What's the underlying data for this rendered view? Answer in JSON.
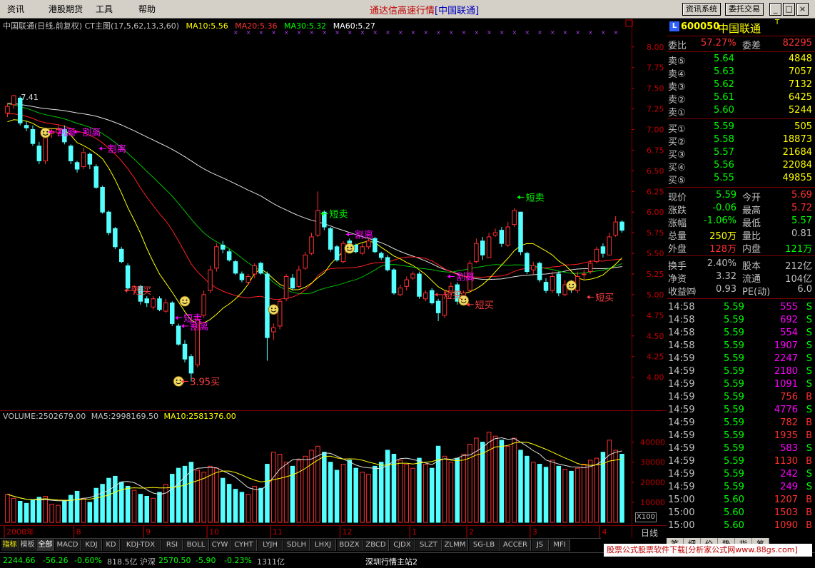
{
  "menu": [
    "资讯",
    "港股期货",
    "工具",
    "帮助"
  ],
  "window": {
    "title": "通达信高速行情",
    "server": "[中国联通]",
    "btn_info": "资讯系统",
    "btn_trade": "委托交易"
  },
  "chart": {
    "main_header": "中国联通(日线,前复权) CT主图(17,5,62,13,3,60)",
    "ma_labels": {
      "ma10": "MA10:5.56",
      "ma20": "MA20:5.36",
      "ma30": "MA30:5.32",
      "ma60": "MA60:5.27"
    },
    "vol_header": "VOLUME:2502679.00",
    "vol_ma5": "MA5:2998169.50",
    "vol_ma10": "MA10:2581376.00",
    "x100": "X100",
    "period": "日线"
  },
  "chart_data": {
    "type": "candlestick",
    "title": "中国联通(日线,前复权)",
    "yticks": [
      "8.00",
      "7.75",
      "7.50",
      "7.25",
      "7.00",
      "6.75",
      "6.50",
      "6.25",
      "6.00",
      "5.75",
      "5.50",
      "5.25",
      "5.00",
      "4.75",
      "4.50",
      "4.25",
      "4.00"
    ],
    "ylim": [
      3.85,
      8.05
    ],
    "vticks": [
      "40000",
      "30000",
      "20000",
      "10000"
    ],
    "vlim": [
      0,
      47000
    ],
    "xlabels": [
      "2008年",
      "8",
      "9",
      "10",
      "11",
      "12",
      "1",
      "2",
      "3",
      "4"
    ],
    "xlabel_index": [
      0,
      11,
      22,
      32,
      42,
      53,
      64,
      73,
      83,
      94
    ],
    "high_label": "7.41",
    "low_label": "3.95",
    "annotations": [
      {
        "text": "割离",
        "i": 6,
        "price": 6.97,
        "color": "#ff00ff"
      },
      {
        "text": "割离",
        "i": 10,
        "price": 6.97,
        "color": "#ff00ff"
      },
      {
        "text": "割离",
        "i": 14,
        "price": 6.77,
        "color": "#ff00ff"
      },
      {
        "text": "短买",
        "i": 18,
        "price": 5.05,
        "color": "#ff4040"
      },
      {
        "text": "短卖",
        "i": 26,
        "price": 4.72,
        "color": "#ff00ff"
      },
      {
        "text": "割离",
        "i": 27,
        "price": 4.62,
        "color": "#ff00ff"
      },
      {
        "text": "3.95买",
        "i": 27,
        "price": 3.95,
        "color": "#ff4040"
      },
      {
        "text": "短卖",
        "i": 49,
        "price": 5.98,
        "color": "#00ff00"
      },
      {
        "text": "割离",
        "i": 53,
        "price": 5.73,
        "color": "#ff00ff"
      },
      {
        "text": "割离",
        "i": 69,
        "price": 5.22,
        "color": "#ff00ff"
      },
      {
        "text": "短买",
        "i": 67,
        "price": 5.0,
        "color": "#ff4040"
      },
      {
        "text": "短买",
        "i": 72,
        "price": 4.88,
        "color": "#ff4040"
      },
      {
        "text": "短卖",
        "i": 80,
        "price": 6.18,
        "color": "#00ff00"
      },
      {
        "text": "短买",
        "i": 91,
        "price": 4.97,
        "color": "#ff4040"
      }
    ],
    "smiles": [
      {
        "i": 6,
        "price": 6.96
      },
      {
        "i": 28,
        "price": 4.92
      },
      {
        "i": 27,
        "price": 3.95
      },
      {
        "i": 42,
        "price": 4.82
      },
      {
        "i": 54,
        "price": 5.56
      },
      {
        "i": 72,
        "price": 4.93
      },
      {
        "i": 89,
        "price": 5.11
      }
    ],
    "close": [
      7.28,
      7.41,
      7.08,
      7.02,
      6.83,
      6.62,
      6.9,
      6.98,
      7.0,
      6.85,
      6.62,
      6.52,
      6.72,
      6.58,
      6.3,
      6.0,
      5.75,
      5.58,
      5.4,
      5.08,
      5.1,
      4.92,
      4.9,
      4.95,
      4.82,
      4.9,
      4.65,
      4.4,
      4.22,
      4.05,
      4.7,
      5.0,
      5.3,
      5.58,
      5.55,
      5.42,
      5.26,
      5.18,
      5.22,
      5.35,
      5.26,
      4.48,
      4.6,
      4.92,
      5.22,
      5.08,
      5.3,
      5.48,
      5.7,
      6.02,
      5.82,
      5.55,
      5.42,
      5.62,
      5.6,
      5.52,
      5.58,
      5.65,
      5.52,
      5.45,
      5.3,
      5.02,
      5.08,
      5.18,
      5.25,
      4.98,
      5.02,
      4.9,
      4.78,
      5.0,
      5.1,
      4.92,
      5.02,
      5.38,
      5.62,
      5.48,
      5.7,
      5.75,
      5.62,
      5.82,
      6.02,
      5.52,
      5.28,
      5.35,
      5.18,
      5.05,
      5.22,
      5.02,
      5.12,
      5.08,
      5.22,
      5.25,
      5.38,
      5.55,
      5.5,
      5.7,
      5.88,
      5.78
    ],
    "open": [
      7.2,
      7.3,
      7.38,
      7.05,
      7.0,
      6.8,
      6.62,
      6.95,
      6.96,
      7.0,
      6.8,
      6.6,
      6.55,
      6.7,
      6.55,
      6.3,
      6.0,
      5.8,
      5.55,
      5.35,
      5.05,
      5.1,
      4.95,
      4.85,
      4.95,
      4.8,
      4.9,
      4.62,
      4.4,
      4.25,
      4.15,
      4.75,
      5.05,
      5.32,
      5.6,
      5.52,
      5.4,
      5.25,
      5.15,
      5.25,
      5.38,
      5.25,
      4.55,
      4.62,
      4.95,
      5.2,
      5.1,
      5.32,
      5.5,
      5.72,
      6.0,
      5.8,
      5.58,
      5.4,
      5.65,
      5.6,
      5.5,
      5.58,
      5.68,
      5.5,
      5.45,
      5.3,
      5.0,
      5.1,
      5.2,
      5.25,
      4.95,
      5.05,
      4.92,
      4.75,
      5.02,
      5.12,
      4.9,
      5.05,
      5.4,
      5.65,
      5.45,
      5.72,
      5.78,
      5.6,
      5.85,
      6.0,
      5.5,
      5.3,
      5.38,
      5.15,
      5.05,
      5.25,
      5.0,
      5.15,
      5.05,
      5.25,
      5.28,
      5.4,
      5.58,
      5.48,
      5.72,
      5.88
    ],
    "high": [
      7.32,
      7.42,
      7.4,
      7.1,
      7.05,
      6.85,
      6.95,
      7.02,
      7.05,
      7.05,
      6.82,
      6.62,
      6.78,
      6.72,
      6.58,
      6.32,
      6.02,
      5.82,
      5.58,
      5.38,
      5.12,
      5.12,
      4.98,
      4.98,
      4.98,
      4.95,
      4.92,
      4.65,
      4.45,
      4.28,
      4.75,
      5.05,
      5.35,
      5.62,
      5.65,
      5.55,
      5.42,
      5.28,
      5.25,
      5.38,
      5.4,
      5.28,
      4.65,
      4.95,
      5.25,
      5.25,
      5.35,
      5.52,
      5.75,
      6.25,
      6.02,
      5.82,
      5.6,
      5.65,
      5.68,
      5.62,
      5.62,
      5.68,
      5.7,
      5.52,
      5.48,
      5.32,
      5.12,
      5.22,
      5.28,
      5.28,
      5.05,
      5.08,
      4.95,
      5.05,
      5.15,
      5.15,
      5.05,
      5.42,
      5.68,
      5.7,
      5.75,
      5.8,
      5.82,
      5.88,
      6.05,
      6.0,
      5.52,
      5.4,
      5.4,
      5.2,
      5.28,
      5.28,
      5.18,
      5.18,
      5.28,
      5.3,
      5.42,
      5.58,
      5.62,
      5.75,
      5.95,
      5.9
    ],
    "low": [
      7.15,
      7.25,
      7.05,
      6.98,
      6.8,
      6.58,
      6.58,
      6.9,
      6.92,
      6.82,
      6.58,
      6.48,
      6.52,
      6.52,
      6.28,
      5.98,
      5.72,
      5.55,
      5.38,
      5.05,
      5.0,
      4.88,
      4.85,
      4.82,
      4.8,
      4.78,
      4.62,
      4.38,
      4.18,
      3.95,
      4.12,
      4.72,
      5.02,
      5.28,
      5.5,
      5.4,
      5.24,
      5.15,
      5.12,
      5.2,
      5.24,
      4.2,
      4.45,
      4.58,
      4.92,
      5.05,
      5.08,
      5.3,
      5.48,
      5.7,
      5.78,
      5.52,
      5.4,
      5.38,
      5.55,
      5.5,
      5.48,
      5.55,
      5.5,
      5.42,
      5.28,
      5.0,
      4.98,
      5.05,
      5.18,
      4.95,
      4.92,
      4.88,
      4.68,
      4.72,
      5.0,
      4.88,
      4.88,
      5.02,
      5.38,
      5.42,
      5.45,
      5.7,
      5.58,
      5.58,
      5.82,
      5.48,
      5.25,
      5.25,
      5.15,
      5.02,
      5.02,
      4.98,
      4.98,
      5.02,
      5.02,
      5.18,
      5.25,
      5.38,
      5.45,
      5.48,
      5.7,
      5.75
    ],
    "volume": [
      14000,
      12000,
      10500,
      9500,
      11000,
      12500,
      13000,
      9000,
      8500,
      10500,
      13500,
      15500,
      12000,
      10000,
      17000,
      19000,
      22000,
      23000,
      20000,
      18000,
      16000,
      14000,
      13000,
      12000,
      15000,
      19000,
      24000,
      27000,
      28000,
      30000,
      26000,
      25000,
      28000,
      27000,
      22000,
      19000,
      16500,
      15000,
      14000,
      18000,
      17000,
      29000,
      35000,
      34000,
      30000,
      28000,
      31000,
      33000,
      36000,
      38000,
      35000,
      30000,
      26000,
      29000,
      31000,
      27000,
      25000,
      24000,
      28000,
      30000,
      36000,
      34000,
      31000,
      29000,
      27000,
      32000,
      29000,
      27000,
      38000,
      33000,
      30000,
      32000,
      34000,
      39000,
      42000,
      40000,
      45000,
      43000,
      41000,
      38000,
      42000,
      36000,
      33000,
      30000,
      29000,
      27500,
      31000,
      28000,
      26500,
      25500,
      27000,
      29000,
      31000,
      32000,
      35000,
      41000,
      36000,
      34000
    ]
  },
  "quote": {
    "code": "600050",
    "name": "中国联通",
    "tflag": "T",
    "wb_label": "委比",
    "wb_value": "57.27%",
    "wc_label": "委差",
    "wc_value": "82295",
    "asks": [
      {
        "l": "卖⑤",
        "p": "5.64",
        "v": "4848"
      },
      {
        "l": "卖④",
        "p": "5.63",
        "v": "7057"
      },
      {
        "l": "卖③",
        "p": "5.62",
        "v": "7132"
      },
      {
        "l": "卖②",
        "p": "5.61",
        "v": "6425"
      },
      {
        "l": "卖①",
        "p": "5.60",
        "v": "5244"
      }
    ],
    "bids": [
      {
        "l": "买①",
        "p": "5.59",
        "v": "505"
      },
      {
        "l": "买②",
        "p": "5.58",
        "v": "18873"
      },
      {
        "l": "买③",
        "p": "5.57",
        "v": "21684"
      },
      {
        "l": "买④",
        "p": "5.56",
        "v": "22084"
      },
      {
        "l": "买⑤",
        "p": "5.55",
        "v": "49855"
      }
    ],
    "stats": [
      {
        "l1": "现价",
        "v1": "5.59",
        "l2": "今开",
        "v2": "5.69"
      },
      {
        "l1": "涨跌",
        "v1": "-0.06",
        "l2": "最高",
        "v2": "5.72"
      },
      {
        "l1": "涨幅",
        "v1": "-1.06%",
        "l2": "最低",
        "v2": "5.57"
      },
      {
        "l1": "总量",
        "v1": "250万",
        "l2": "量比",
        "v2": "0.81"
      },
      {
        "l1": "外盘",
        "v1": "128万",
        "l2": "内盘",
        "v2": "121万"
      }
    ],
    "fin": [
      {
        "l1": "换手",
        "v1": "2.40%",
        "l2": "股本",
        "v2": "212亿"
      },
      {
        "l1": "净资",
        "v1": "3.32",
        "l2": "流通",
        "v2": "104亿"
      },
      {
        "l1": "收益㈣",
        "v1": "0.93",
        "l2": "PE(动)",
        "v2": "6.0"
      }
    ],
    "ticks": [
      {
        "t": "14:58",
        "p": "5.59",
        "v": "555",
        "s": "S"
      },
      {
        "t": "14:58",
        "p": "5.59",
        "v": "692",
        "s": "S"
      },
      {
        "t": "14:58",
        "p": "5.59",
        "v": "554",
        "s": "S"
      },
      {
        "t": "14:58",
        "p": "5.59",
        "v": "1907",
        "s": "S"
      },
      {
        "t": "14:59",
        "p": "5.59",
        "v": "2247",
        "s": "S"
      },
      {
        "t": "14:59",
        "p": "5.59",
        "v": "2180",
        "s": "S"
      },
      {
        "t": "14:59",
        "p": "5.59",
        "v": "1091",
        "s": "S"
      },
      {
        "t": "14:59",
        "p": "5.59",
        "v": "756",
        "s": "B"
      },
      {
        "t": "14:59",
        "p": "5.59",
        "v": "4776",
        "s": "S"
      },
      {
        "t": "14:59",
        "p": "5.59",
        "v": "782",
        "s": "B"
      },
      {
        "t": "14:59",
        "p": "5.59",
        "v": "1935",
        "s": "B"
      },
      {
        "t": "14:59",
        "p": "5.59",
        "v": "583",
        "s": "S"
      },
      {
        "t": "14:59",
        "p": "5.59",
        "v": "1130",
        "s": "B"
      },
      {
        "t": "14:59",
        "p": "5.59",
        "v": "242",
        "s": "S"
      },
      {
        "t": "14:59",
        "p": "5.59",
        "v": "249",
        "s": "S"
      },
      {
        "t": "15:00",
        "p": "5.60",
        "v": "1207",
        "s": "B"
      },
      {
        "t": "15:00",
        "p": "5.60",
        "v": "1503",
        "s": "B"
      },
      {
        "t": "15:00",
        "p": "5.60",
        "v": "1090",
        "s": "B"
      }
    ],
    "bottom_tabs": [
      "笔",
      "细",
      "价",
      "势",
      "指",
      "筹"
    ]
  },
  "tabs": [
    "指标",
    "模板",
    "全部",
    "MACD",
    "KDJ",
    "KD",
    "KDJ-TDX",
    "RSI",
    "BOLL",
    "CYW",
    "CYHT",
    "LYJH",
    "SDLH",
    "LHXJ",
    "BDZX",
    "ZBCD",
    "CJDX",
    "SLZT",
    "ZLMM",
    "SG-LB",
    "ACCER",
    "JS",
    "MFI"
  ],
  "status": {
    "sh_index": "2244.66",
    "sh_chg": "-56.26",
    "sh_pct": "-0.60%",
    "sh_amt": "818.5亿",
    "sz_label": "沪深",
    "sz_index": "2570.50",
    "sz_chg": "-5.90",
    "sz_pct": "-0.23%",
    "sz_amt": "1311亿",
    "site": "深圳行情主站2"
  },
  "ad": "股票公式股票软件下载[分析家公式网www.88gs.com]"
}
